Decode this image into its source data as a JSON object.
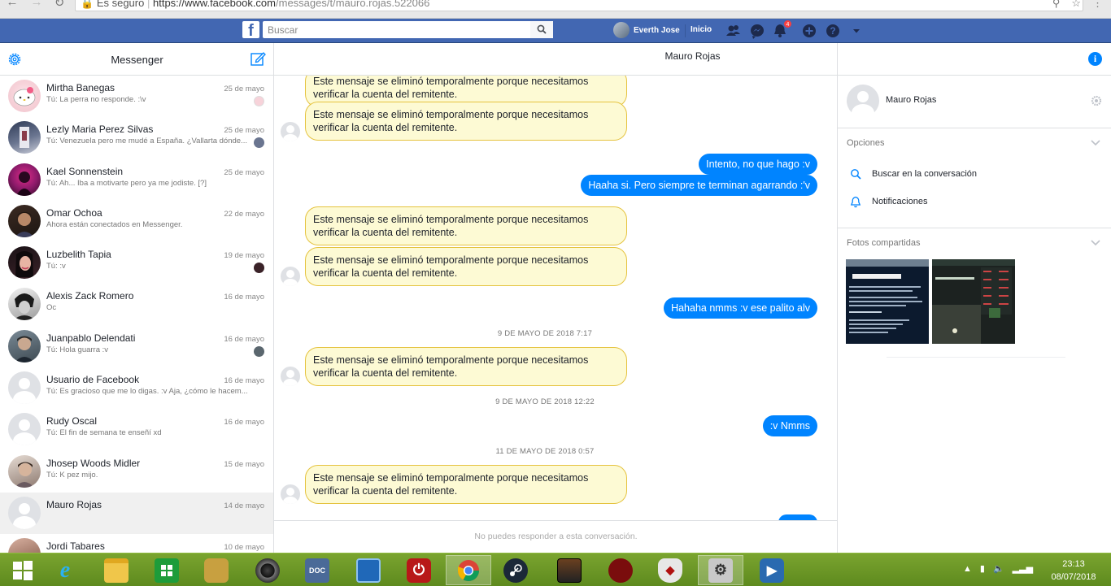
{
  "browser": {
    "secure_label": "Es seguro",
    "url_main": "https://www.facebook.com",
    "url_path": "/messages/t/mauro.rojas.522066"
  },
  "topbar": {
    "search_placeholder": "Buscar",
    "user_name": "Everth Jose",
    "home_label": "Inicio",
    "notification_count": "4"
  },
  "left": {
    "title": "Messenger",
    "conversations": [
      {
        "name": "Mirtha Banegas",
        "snippet": "Tú: La perra no responde. :\\v",
        "date": "25 de mayo"
      },
      {
        "name": "Lezly Maria Perez Silvas",
        "snippet": "Tú: Venezuela pero me mudé a España. ¿Vallarta dónde...",
        "date": "25 de mayo"
      },
      {
        "name": "Kael Sonnenstein",
        "snippet": "Tú: Ah... Iba a motivarte pero ya me jodiste. [?]",
        "date": "25 de mayo"
      },
      {
        "name": "Omar Ochoa",
        "snippet": "Ahora están conectados en Messenger.",
        "date": "22 de mayo"
      },
      {
        "name": "Luzbelith Tapia",
        "snippet": "Tú: :v",
        "date": "19 de mayo"
      },
      {
        "name": "Alexis Zack Romero",
        "snippet": "Oc",
        "date": "16 de mayo"
      },
      {
        "name": "Juanpablo Delendati",
        "snippet": "Tú: Hola guarra :v",
        "date": "16 de mayo"
      },
      {
        "name": "Usuario de Facebook",
        "snippet": "Tú: Es gracioso que me lo digas. :v Aja, ¿cómo le hacem...",
        "date": "16 de mayo"
      },
      {
        "name": "Rudy Oscal",
        "snippet": "Tú: El fin de semana te enseñí xd",
        "date": "16 de mayo"
      },
      {
        "name": "Jhosep Woods Midler",
        "snippet": "Tú: K pez mijo.",
        "date": "15 de mayo"
      },
      {
        "name": "Mauro Rojas",
        "snippet": "",
        "date": "14 de mayo"
      },
      {
        "name": "Jordi Tabares",
        "snippet": "",
        "date": "10 de mayo"
      }
    ]
  },
  "chat": {
    "title": "Mauro Rojas",
    "removed_message": "Este mensaje se eliminó temporalmente porque necesitamos verificar la cuenta del remitente.",
    "sent": [
      "Intento, no que hago :v",
      "Haaha si. Pero siempre te terminan agarrando :'v",
      "Hahaha nmms :v ese palito alv",
      ":v Nmms"
    ],
    "timestamps": [
      "9 DE MAYO DE 2018 7:17",
      "9 DE MAYO DE 2018 12:22",
      "11 DE MAYO DE 2018 0:57"
    ],
    "composer_notice": "No puedes responder a esta conversación."
  },
  "right": {
    "name": "Mauro Rojas",
    "options_label": "Opciones",
    "search_label": "Buscar en la conversación",
    "notifications_label": "Notificaciones",
    "photos_label": "Fotos compartidas"
  },
  "taskbar": {
    "time": "23:13",
    "date": "08/07/2018"
  },
  "colors": {
    "fb_blue": "#4267b2",
    "messenger_blue": "#0084ff",
    "removed_bg": "#fdfad4",
    "removed_border": "#e5c33f"
  }
}
